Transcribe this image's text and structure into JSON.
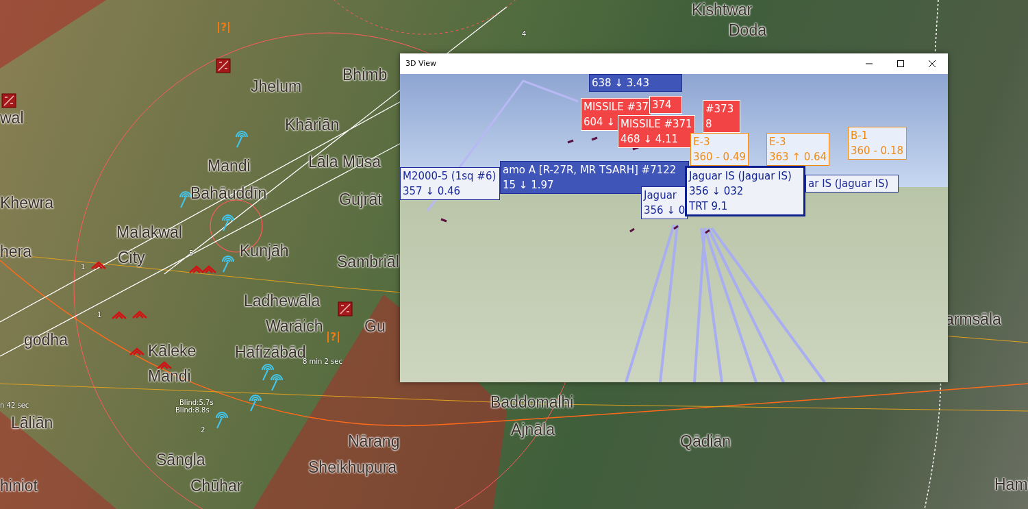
{
  "map_labels": [
    {
      "text": "Kishtwar"
    },
    {
      "text": "Doda"
    },
    {
      "text": "Bhimb"
    },
    {
      "text": "Jhelum"
    },
    {
      "text": "wal"
    },
    {
      "text": "Khāriān"
    },
    {
      "text": "Mandi"
    },
    {
      "text": "Lāla Mūsa"
    },
    {
      "text": "Khewra"
    },
    {
      "text": "Bahāuddīn"
    },
    {
      "text": "Gujrāt"
    },
    {
      "text": "Malakwal"
    },
    {
      "text": "hera"
    },
    {
      "text": "City"
    },
    {
      "text": "Kunjāh"
    },
    {
      "text": "Sambriāl"
    },
    {
      "text": "Ladhewāla"
    },
    {
      "text": "Warāich"
    },
    {
      "text": "Gu"
    },
    {
      "text": "armsāla"
    },
    {
      "text": "godha"
    },
    {
      "text": "Kāleke"
    },
    {
      "text": "Hāfizābād"
    },
    {
      "text": "Mandi"
    },
    {
      "text": "Baddomalhi"
    },
    {
      "text": "Lāliān"
    },
    {
      "text": "Ajnāla"
    },
    {
      "text": "Nārang"
    },
    {
      "text": "Qādiān"
    },
    {
      "text": "Sāngla"
    },
    {
      "text": "Sheikhupura"
    },
    {
      "text": "hiniot"
    },
    {
      "text": "Chūhar"
    },
    {
      "text": "Hami"
    }
  ],
  "map_notes": [
    {
      "text": "4"
    },
    {
      "text": "5"
    },
    {
      "text": "1"
    },
    {
      "text": "1"
    },
    {
      "text": "8 min 2 sec"
    },
    {
      "text": "Blind:5.7s"
    },
    {
      "text": "n 42 sec"
    },
    {
      "text": "Blind:8.8s"
    },
    {
      "text": "2"
    }
  ],
  "unknown_markers": [
    {
      "text": "?"
    },
    {
      "text": "?"
    }
  ],
  "window": {
    "title": "3D View"
  },
  "track_labels": [
    {
      "kind": "friendly_solid",
      "lines": [
        "638 ↓ 3.43"
      ]
    },
    {
      "kind": "missile",
      "lines": [
        "MISSILE #37",
        "604 ↓"
      ]
    },
    {
      "kind": "missile",
      "lines": [
        "374"
      ]
    },
    {
      "kind": "missile",
      "lines": [
        "#373",
        "8"
      ]
    },
    {
      "kind": "missile",
      "lines": [
        "MISSILE #371",
        "468 ↓ 4.11"
      ]
    },
    {
      "kind": "unknown",
      "lines": [
        "B-1",
        "360 - 0.18"
      ]
    },
    {
      "kind": "unknown",
      "lines": [
        "E-3",
        "360 - 0.49"
      ]
    },
    {
      "kind": "unknown",
      "lines": [
        "E-3",
        "363 ↑ 0.64"
      ]
    },
    {
      "kind": "friendly",
      "lines": [
        "M2000-5 (1sq #6)",
        "357 ↓ 0.46"
      ]
    },
    {
      "kind": "friendly_solid",
      "lines": [
        "amo A [R-27R, MR TSARH] #7122",
        "15 ↓ 1.97"
      ]
    },
    {
      "kind": "friendly",
      "lines": [
        "Jaguar",
        "356 ↓ 0"
      ]
    },
    {
      "kind": "friendly_selected",
      "lines": [
        "Jaguar IS (Jaguar IS)",
        "356 ↓ 032",
        "TRT 9.1"
      ]
    },
    {
      "kind": "friendly",
      "lines": [
        "ar IS (Jaguar IS)"
      ]
    }
  ]
}
